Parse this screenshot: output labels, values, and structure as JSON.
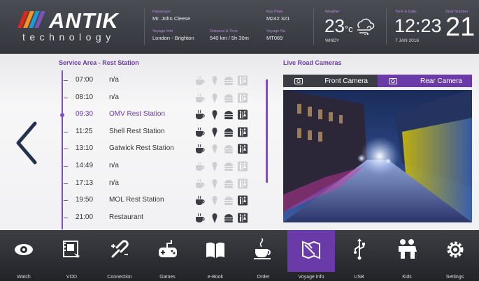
{
  "brand": {
    "name": "ANTIK",
    "sub": "technology",
    "slash_colors": [
      "#e1261c",
      "#f7941d",
      "#1a9ad6",
      "#7c52b5"
    ]
  },
  "info": {
    "passenger_label": "Passenger",
    "passenger_value": "Mr. John Cleese",
    "voyage_label": "Voyage Info",
    "voyage_value": "London - Brighton",
    "distance_label": "Distance & Time",
    "distance_value": "540 km / 5h 30m",
    "plate_label": "Bus Plate",
    "plate_value": "M242 321",
    "voyage_no_label": "Voyage No.",
    "voyage_no_value": "MT069",
    "weather_label": "Weather",
    "weather_temp": "23",
    "weather_unit": "°c",
    "weather_cond": "WINDY",
    "time_label": "Time & Date",
    "time_value": "12:23",
    "date_value": "7 JAN 2016",
    "seat_label": "Seat Number",
    "seat_value": "21"
  },
  "service": {
    "title": "Service Area - Rest Station",
    "rows": [
      {
        "time": "07:00",
        "name": "n/a",
        "amenities": "none"
      },
      {
        "time": "08:10",
        "name": "n/a",
        "amenities": "none"
      },
      {
        "time": "09:30",
        "name": "OMV Rest Station",
        "amenities": "full"
      },
      {
        "time": "11:25",
        "name": "Shell Rest Station",
        "amenities": "full"
      },
      {
        "time": "13:10",
        "name": "Gatwick Rest Station",
        "amenities": "partial"
      },
      {
        "time": "14:49",
        "name": "n/a",
        "amenities": "none"
      },
      {
        "time": "17:13",
        "name": "n/a",
        "amenities": "none"
      },
      {
        "time": "19:50",
        "name": "MOL Rest Station",
        "amenities": "partial"
      },
      {
        "time": "21:00",
        "name": "Restaurant",
        "amenities": "full"
      }
    ],
    "active_row": 2
  },
  "cameras": {
    "title": "Live Road Cameras",
    "front_label": "Front Camera",
    "rear_label": "Rear Camera",
    "active": "rear"
  },
  "dock": {
    "items": [
      {
        "label": "Watch",
        "icon": "eye-icon"
      },
      {
        "label": "VOD",
        "icon": "film-icon"
      },
      {
        "label": "Connection",
        "icon": "connection-icon"
      },
      {
        "label": "Games",
        "icon": "gamepad-icon"
      },
      {
        "label": "e-Book",
        "icon": "book-icon"
      },
      {
        "label": "Order",
        "icon": "coffee-icon"
      },
      {
        "label": "Voyage Info",
        "icon": "map-icon"
      },
      {
        "label": "USB",
        "icon": "usb-icon"
      },
      {
        "label": "Kids",
        "icon": "kids-icon"
      },
      {
        "label": "Settings",
        "icon": "gear-icon"
      }
    ],
    "active_index": 6
  },
  "colors": {
    "accent": "#6a3aa8",
    "active_amenity": "#3b3d44",
    "inactive_amenity": "#cfcfd2"
  }
}
